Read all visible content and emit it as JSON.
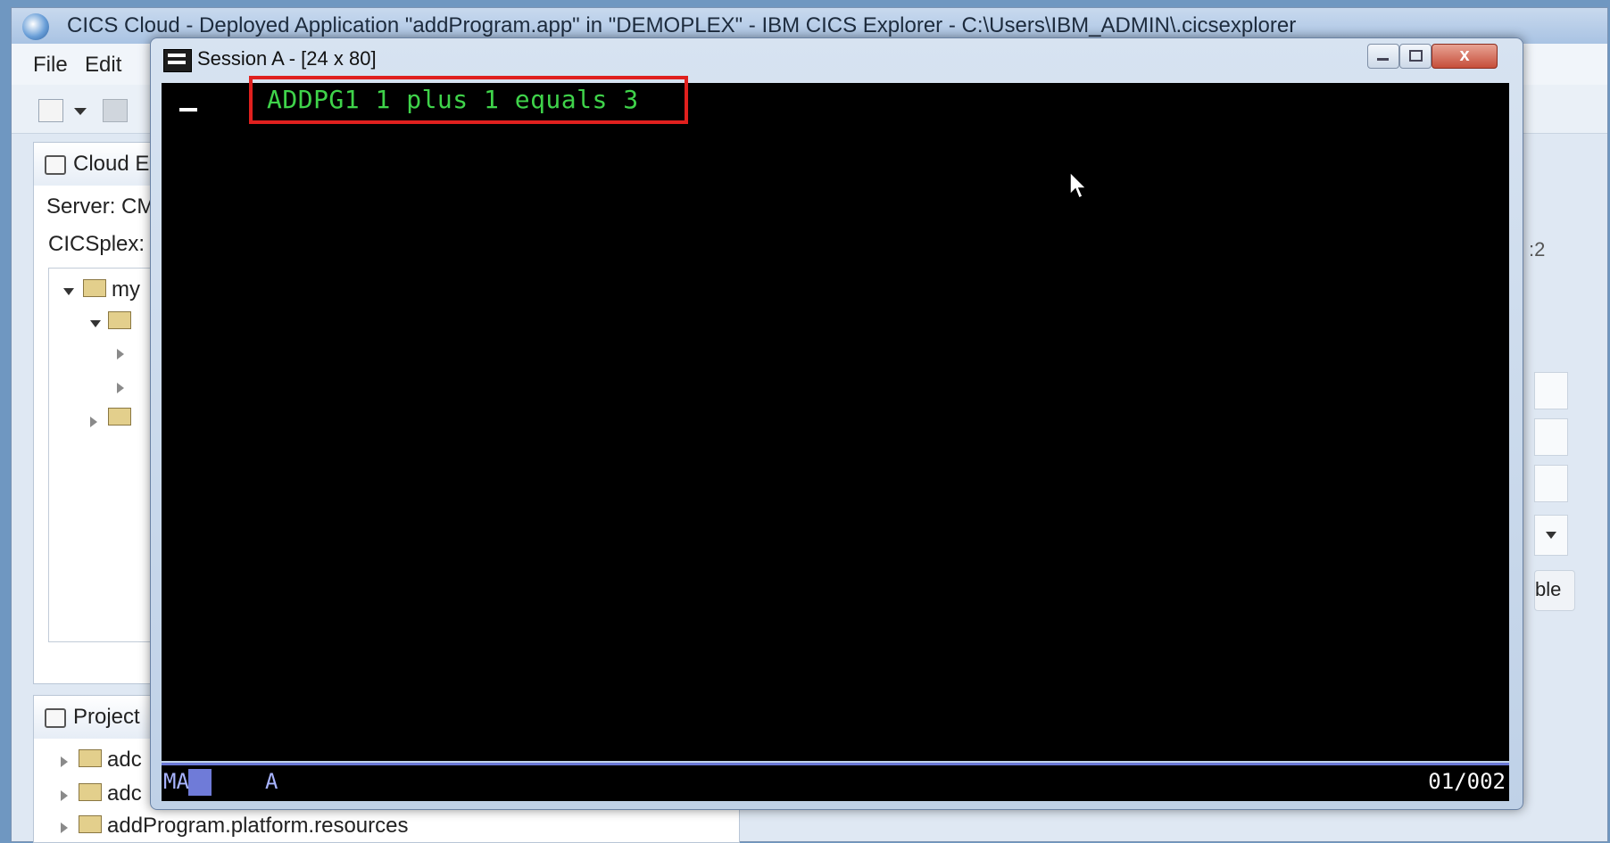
{
  "background_app": {
    "title": "CICS Cloud - Deployed Application \"addProgram.app\" in \"DEMOPLEX\" - IBM CICS Explorer - C:\\Users\\IBM_ADMIN\\.cicsexplorer",
    "menu": [
      {
        "label": "File"
      },
      {
        "label": "Edit"
      }
    ],
    "cloud_panel": {
      "title": "Cloud E",
      "server_label": "Server: CM",
      "cicsplex_label": "CICSplex:",
      "tree_root": "my"
    },
    "project_panel": {
      "title": "Project",
      "items": [
        {
          "label": "adc"
        },
        {
          "label": "adc"
        },
        {
          "label": "addProgram.platform.resources"
        }
      ]
    },
    "right_fragments": {
      "button_partial": "ble",
      "edge_char": ":2"
    }
  },
  "session": {
    "title": "Session A - [24 x 80]",
    "close_label": "x",
    "terminal_line": "ADDPG1 1 plus 1 equals 3",
    "status_bar": {
      "left_indicator": "MA",
      "mode": "A",
      "cursor_position": "01/002"
    }
  },
  "colors": {
    "terminal_text": "#3fd34a",
    "highlight_box": "#e0201e",
    "oia_accent": "#6a78d6"
  }
}
